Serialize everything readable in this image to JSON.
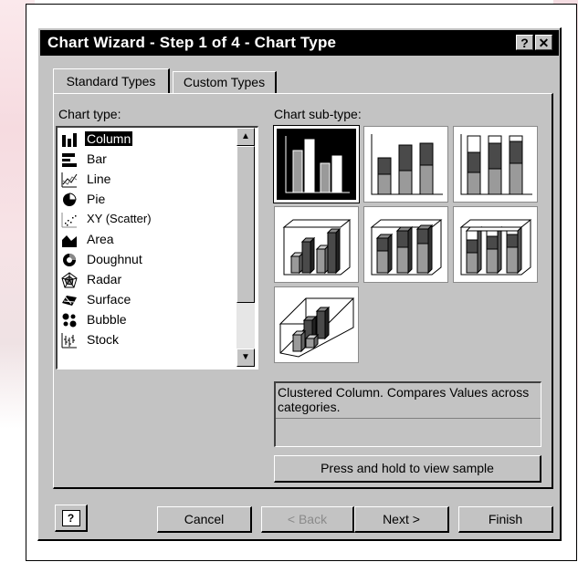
{
  "window": {
    "title": "Chart Wizard - Step 1 of 4 - Chart Type",
    "help_glyph": "?",
    "close_glyph": "✕"
  },
  "tabs": [
    {
      "label": "Standard Types",
      "active": true
    },
    {
      "label": "Custom Types",
      "active": false
    }
  ],
  "chart_type": {
    "label": "Chart type:",
    "items": [
      {
        "label": "Column",
        "icon": "column-chart-icon",
        "selected": true
      },
      {
        "label": "Bar",
        "icon": "bar-chart-icon"
      },
      {
        "label": "Line",
        "icon": "line-chart-icon"
      },
      {
        "label": "Pie",
        "icon": "pie-chart-icon"
      },
      {
        "label": "XY (Scatter)",
        "icon": "scatter-chart-icon"
      },
      {
        "label": "Area",
        "icon": "area-chart-icon"
      },
      {
        "label": "Doughnut",
        "icon": "doughnut-chart-icon"
      },
      {
        "label": "Radar",
        "icon": "radar-chart-icon"
      },
      {
        "label": "Surface",
        "icon": "surface-chart-icon"
      },
      {
        "label": "Bubble",
        "icon": "bubble-chart-icon"
      },
      {
        "label": "Stock",
        "icon": "stock-chart-icon"
      }
    ]
  },
  "sub_type": {
    "label": "Chart sub-type:",
    "description": "Clustered Column. Compares Values across categories.",
    "sample_button": "Press and hold to view sample"
  },
  "footer": {
    "help_glyph": "?",
    "cancel": "Cancel",
    "back": "< Back",
    "next": "Next >",
    "finish": "Finish"
  },
  "colors": {
    "dialog_face": "#c3c3c3",
    "title_bar": "#000000",
    "bar_gray": "#9a9a9a",
    "bar_dark": "#4a4a4a"
  }
}
